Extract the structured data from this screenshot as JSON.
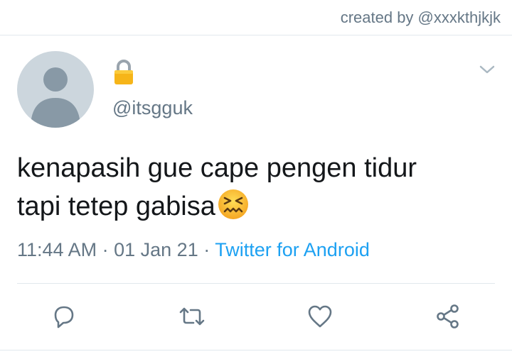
{
  "watermark": {
    "text": "created by @xxxkthjkjk"
  },
  "tweet": {
    "lock_icon": "lock-icon",
    "handle": "@itsgguk",
    "text_line1": "kenapasih gue cape pengen tidur",
    "text_line2": "tapi tetep gabisa",
    "emoji": "confounded-face-emoji",
    "time": "11:44 AM",
    "date": "01 Jan 21",
    "separator": "·",
    "source": "Twitter for Android"
  },
  "actions": [
    {
      "name": "reply",
      "icon": "reply-icon"
    },
    {
      "name": "retweet",
      "icon": "retweet-icon"
    },
    {
      "name": "like",
      "icon": "heart-icon"
    },
    {
      "name": "share",
      "icon": "share-icon"
    }
  ],
  "colors": {
    "text": "#14171a",
    "secondary": "#657786",
    "link": "#1da1f2",
    "divider": "#e1e8ed",
    "avatar_bg": "#ccd6dd",
    "avatar_fg": "#8899a6"
  }
}
